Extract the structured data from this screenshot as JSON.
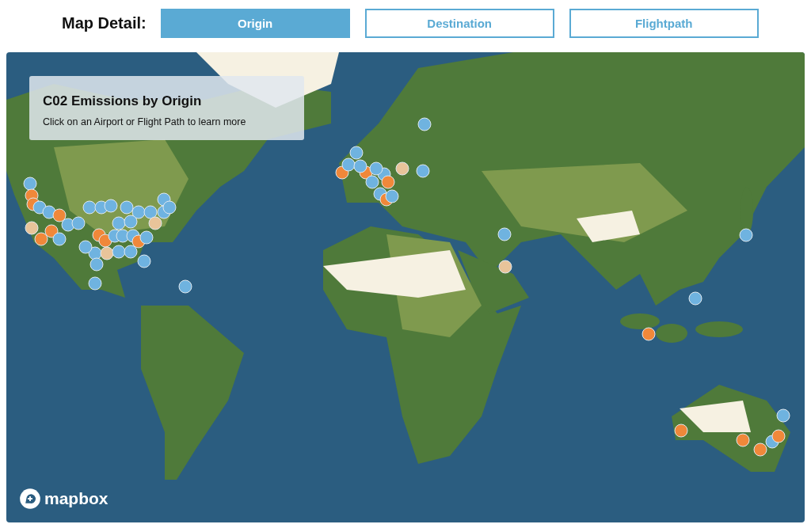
{
  "map_detail": {
    "label": "Map Detail:",
    "tabs": [
      {
        "label": "Origin",
        "selected": true
      },
      {
        "label": "Destination",
        "selected": false
      },
      {
        "label": "Flightpath",
        "selected": false
      }
    ]
  },
  "info_panel": {
    "title": "C02 Emissions by Origin",
    "subtitle": "Click on an Airport or Flight Path to learn more"
  },
  "attribution": {
    "logo_text": "mapbox"
  },
  "airports": [
    {
      "color": "#6fb3e0"
    },
    {
      "color": "#f0883a"
    },
    {
      "color": "#f0883a"
    },
    {
      "color": "#6fb3e0"
    },
    {
      "color": "#e8c49a"
    },
    {
      "color": "#6fb3e0"
    },
    {
      "color": "#f0883a"
    },
    {
      "color": "#f0883a"
    },
    {
      "color": "#f0883a"
    },
    {
      "color": "#6fb3e0"
    },
    {
      "color": "#6fb3e0"
    },
    {
      "color": "#6fb3e0"
    },
    {
      "color": "#6fb3e0"
    },
    {
      "color": "#6fb3e0"
    },
    {
      "color": "#6fb3e0"
    },
    {
      "color": "#6fb3e0"
    },
    {
      "color": "#6fb3e0"
    },
    {
      "color": "#6fb3e0"
    },
    {
      "color": "#6fb3e0"
    },
    {
      "color": "#6fb3e0"
    },
    {
      "color": "#6fb3e0"
    },
    {
      "color": "#e8c49a"
    },
    {
      "color": "#f0883a"
    },
    {
      "color": "#f0883a"
    },
    {
      "color": "#6fb3e0"
    },
    {
      "color": "#6fb3e0"
    },
    {
      "color": "#6fb3e0"
    },
    {
      "color": "#f0883a"
    },
    {
      "color": "#6fb3e0"
    },
    {
      "color": "#6fb3e0"
    },
    {
      "color": "#e8c49a"
    },
    {
      "color": "#6fb3e0"
    },
    {
      "color": "#6fb3e0"
    },
    {
      "color": "#6fb3e0"
    },
    {
      "color": "#6fb3e0"
    },
    {
      "color": "#6fb3e0"
    },
    {
      "color": "#6fb3e0"
    },
    {
      "color": "#6fb3e0"
    },
    {
      "color": "#6fb3e0"
    },
    {
      "color": "#6fb3e0"
    },
    {
      "color": "#f0883a"
    },
    {
      "color": "#6fb3e0"
    },
    {
      "color": "#6fb3e0"
    },
    {
      "color": "#f0883a"
    },
    {
      "color": "#6fb3e0"
    },
    {
      "color": "#6fb3e0"
    },
    {
      "color": "#f0883a"
    },
    {
      "color": "#e8c49a"
    },
    {
      "color": "#6fb3e0"
    },
    {
      "color": "#6fb3e0"
    },
    {
      "color": "#6fb3e0"
    },
    {
      "color": "#f0883a"
    },
    {
      "color": "#6fb3e0"
    },
    {
      "color": "#6fb3e0"
    },
    {
      "color": "#6fb3e0"
    },
    {
      "color": "#6fb3e0"
    },
    {
      "color": "#e8c49a"
    },
    {
      "color": "#6fb3e0"
    },
    {
      "color": "#6fb3e0"
    },
    {
      "color": "#f0883a"
    },
    {
      "color": "#f0883a"
    },
    {
      "color": "#f0883a"
    },
    {
      "color": "#f0883a"
    },
    {
      "color": "#6fb3e0"
    },
    {
      "color": "#f0883a"
    },
    {
      "color": "#6fb3e0"
    }
  ]
}
